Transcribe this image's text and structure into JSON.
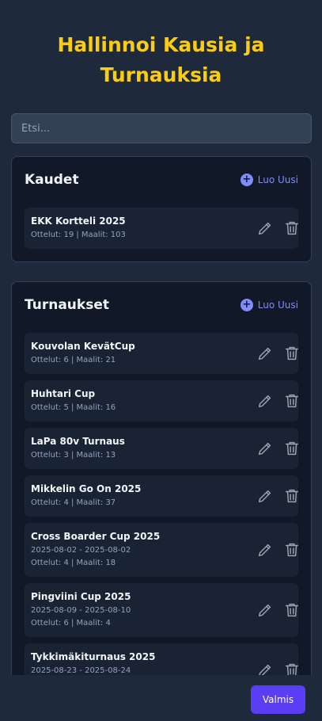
{
  "title_line1": "Hallinnoi Kausia ja",
  "title_line2": "Turnauksia",
  "search": {
    "placeholder": "Etsi..."
  },
  "seasons": {
    "title": "Kaudet",
    "new_label": "Luo Uusi",
    "items": [
      {
        "name": "EKK Kortteli 2025",
        "stats": "Ottelut: 19 | Maalit: 103"
      }
    ]
  },
  "tournaments": {
    "title": "Turnaukset",
    "new_label": "Luo Uusi",
    "items": [
      {
        "name": "Kouvolan KevätCup",
        "stats": "Ottelut: 6 | Maalit: 21"
      },
      {
        "name": "Huhtari Cup",
        "stats": "Ottelut: 5 | Maalit: 16"
      },
      {
        "name": "LaPa 80v Turnaus",
        "stats": "Ottelut: 3 | Maalit: 13"
      },
      {
        "name": "Mikkelin Go On 2025",
        "stats": "Ottelut: 4 | Maalit: 37"
      },
      {
        "name": "Cross Boarder Cup 2025",
        "dates": "2025-08-02 - 2025-08-02",
        "stats": "Ottelut: 4 | Maalit: 18"
      },
      {
        "name": "Pingviini Cup 2025",
        "dates": "2025-08-09 - 2025-08-10",
        "stats": "Ottelut: 6 | Maalit: 4"
      },
      {
        "name": "Tykkimäkiturnaus 2025",
        "dates": "2025-08-23 - 2025-08-24"
      }
    ]
  },
  "done_label": "Valmis"
}
